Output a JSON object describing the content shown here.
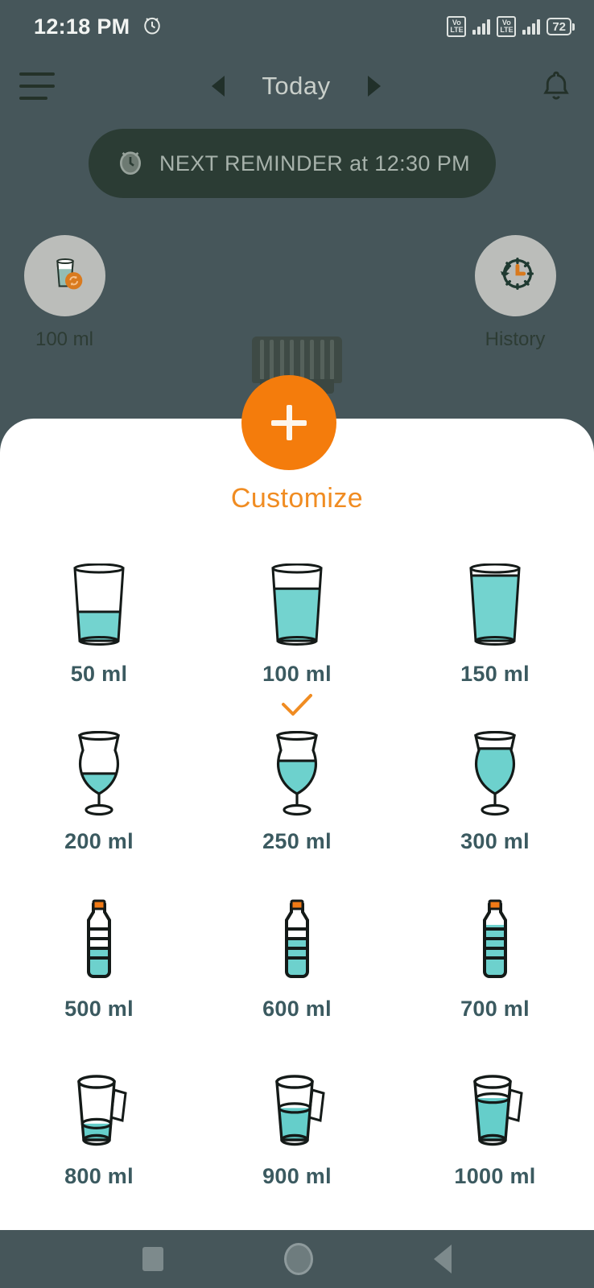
{
  "status_bar": {
    "time": "12:18 PM",
    "alarm_icon": "alarm-icon",
    "sim1_volte_top": "Vo",
    "sim1_volte_bottom": "LTE",
    "sim2_volte_top": "Vo",
    "sim2_volte_bottom": "LTE",
    "battery_percent": "72"
  },
  "header": {
    "menu_icon": "hamburger-menu-icon",
    "prev_icon": "chevron-left-icon",
    "date_label": "Today",
    "next_icon": "chevron-right-icon",
    "bell_icon": "bell-icon"
  },
  "reminder": {
    "icon": "alarm-clock-icon",
    "text": "NEXT REMINDER at 12:30 PM"
  },
  "quick_actions": {
    "quick_add": {
      "icon": "glass-refresh-icon",
      "label": "100 ml"
    },
    "history": {
      "icon": "clock-history-icon",
      "label": "History"
    }
  },
  "fab": {
    "icon": "plus-icon",
    "label": "+"
  },
  "sheet": {
    "title": "Customize",
    "selected_volume": "100 ml",
    "check_icon": "check-icon",
    "options": [
      {
        "label": "50 ml",
        "vessel": "glass",
        "fill": 0.4,
        "selected": false
      },
      {
        "label": "100 ml",
        "vessel": "glass",
        "fill": 0.72,
        "selected": true
      },
      {
        "label": "150 ml",
        "vessel": "glass",
        "fill": 0.9,
        "selected": false
      },
      {
        "label": "200 ml",
        "vessel": "goblet",
        "fill": 0.38,
        "selected": false
      },
      {
        "label": "250 ml",
        "vessel": "goblet",
        "fill": 0.62,
        "selected": false
      },
      {
        "label": "300 ml",
        "vessel": "goblet",
        "fill": 0.85,
        "selected": false
      },
      {
        "label": "500 ml",
        "vessel": "bottle",
        "fill": 0.38,
        "selected": false
      },
      {
        "label": "600 ml",
        "vessel": "bottle",
        "fill": 0.55,
        "selected": false
      },
      {
        "label": "700 ml",
        "vessel": "bottle",
        "fill": 0.72,
        "selected": false
      },
      {
        "label": "800 ml",
        "vessel": "jug",
        "fill": 0.28,
        "selected": false
      },
      {
        "label": "900 ml",
        "vessel": "jug",
        "fill": 0.55,
        "selected": false
      },
      {
        "label": "1000 ml",
        "vessel": "jug",
        "fill": 0.72,
        "selected": false
      }
    ]
  },
  "navbar": {
    "recents_icon": "square-recents-icon",
    "home_icon": "circle-home-icon",
    "back_icon": "triangle-back-icon"
  },
  "colors": {
    "background": "#46565a",
    "sheet": "#ffffff",
    "accent_orange": "#f47c0c",
    "title_orange": "#f08c22",
    "label_teal": "#3b5a60",
    "water_teal": "#54c9c4",
    "pill_green": "#2b3c34"
  }
}
